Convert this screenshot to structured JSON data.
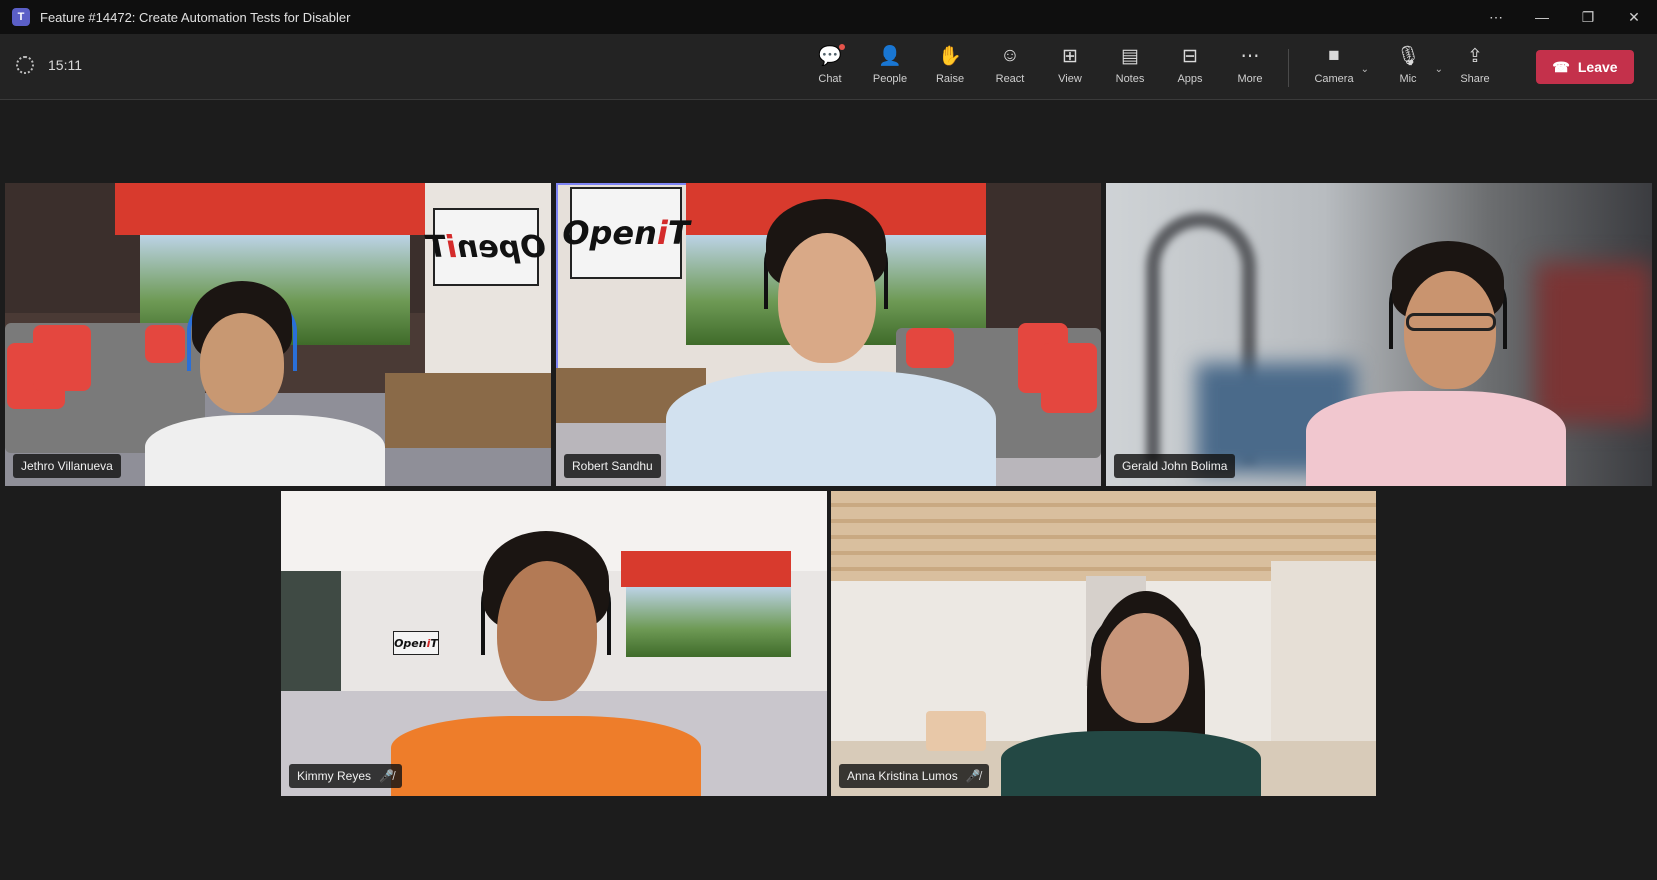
{
  "window": {
    "title": "Feature #14472: Create Automation Tests for Disabler",
    "controls": [
      "⋯",
      "—",
      "❐",
      "✕"
    ]
  },
  "meeting": {
    "timer": "15:11"
  },
  "toolbar": {
    "items": [
      {
        "label": "Chat",
        "icon": "chat-icon"
      },
      {
        "label": "People",
        "icon": "people-icon"
      },
      {
        "label": "Raise",
        "icon": "raise-hand-icon"
      },
      {
        "label": "React",
        "icon": "react-icon"
      },
      {
        "label": "View",
        "icon": "view-icon"
      },
      {
        "label": "Notes",
        "icon": "notes-icon"
      },
      {
        "label": "Apps",
        "icon": "apps-icon"
      },
      {
        "label": "More",
        "icon": "more-icon"
      },
      {
        "label": "Camera",
        "icon": "camera-icon"
      },
      {
        "label": "Mic",
        "icon": "mic-icon"
      },
      {
        "label": "Share",
        "icon": "share-icon"
      }
    ],
    "leave_label": "Leave"
  },
  "participants": [
    {
      "name": "Jethro Villanueva",
      "muted": false
    },
    {
      "name": "Robert Sandhu",
      "muted": false,
      "active_speaker": true
    },
    {
      "name": "Gerald John Bolima",
      "muted": false
    },
    {
      "name": "Kimmy Reyes",
      "muted": true
    },
    {
      "name": "Anna Kristina Lumos",
      "muted": true
    }
  ],
  "colors": {
    "accent": "#7f85f5",
    "leave": "#c4314b",
    "background": "#1c1c1c"
  }
}
